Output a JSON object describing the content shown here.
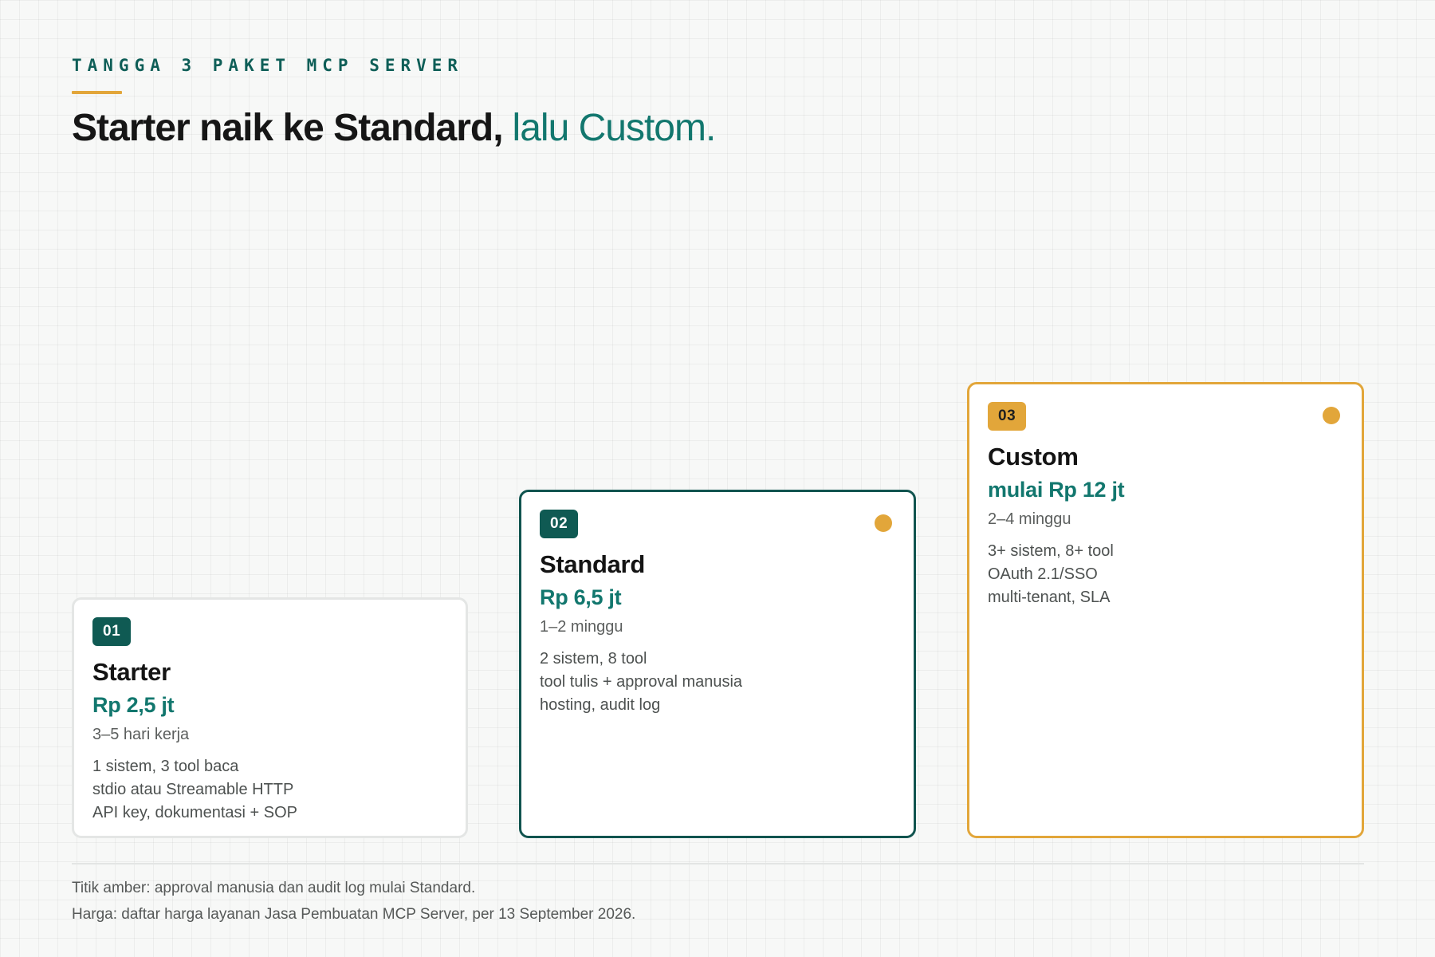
{
  "header": {
    "eyebrow": "TANGGA 3 PAKET MCP SERVER",
    "headline_strong": "Starter naik ke Standard,",
    "headline_accent": "lalu Custom."
  },
  "colors": {
    "teal_dark": "#0f5a53",
    "teal_accent": "#12776e",
    "amber": "#e2a63a",
    "card_border_light": "#e4e6e5"
  },
  "plans": [
    {
      "number": "01",
      "name": "Starter",
      "price": "Rp 2,5 jt",
      "duration": "3–5 hari kerja",
      "features": [
        "1 sistem, 3 tool baca",
        "stdio atau Streamable HTTP",
        "API key, dokumentasi + SOP"
      ],
      "amber_dot": false
    },
    {
      "number": "02",
      "name": "Standard",
      "price": "Rp 6,5 jt",
      "duration": "1–2 minggu",
      "features": [
        "2 sistem, 8 tool",
        "tool tulis + approval manusia",
        "hosting, audit log"
      ],
      "amber_dot": true
    },
    {
      "number": "03",
      "name": "Custom",
      "price": "mulai Rp 12 jt",
      "duration": "2–4 minggu",
      "features": [
        "3+ sistem, 8+ tool",
        "OAuth 2.1/SSO",
        "multi-tenant, SLA"
      ],
      "amber_dot": true
    }
  ],
  "footer": {
    "note_1": "Titik amber: approval manusia dan audit log mulai Standard.",
    "note_2": "Harga: daftar harga layanan Jasa Pembuatan MCP Server, per 13 September 2026."
  }
}
